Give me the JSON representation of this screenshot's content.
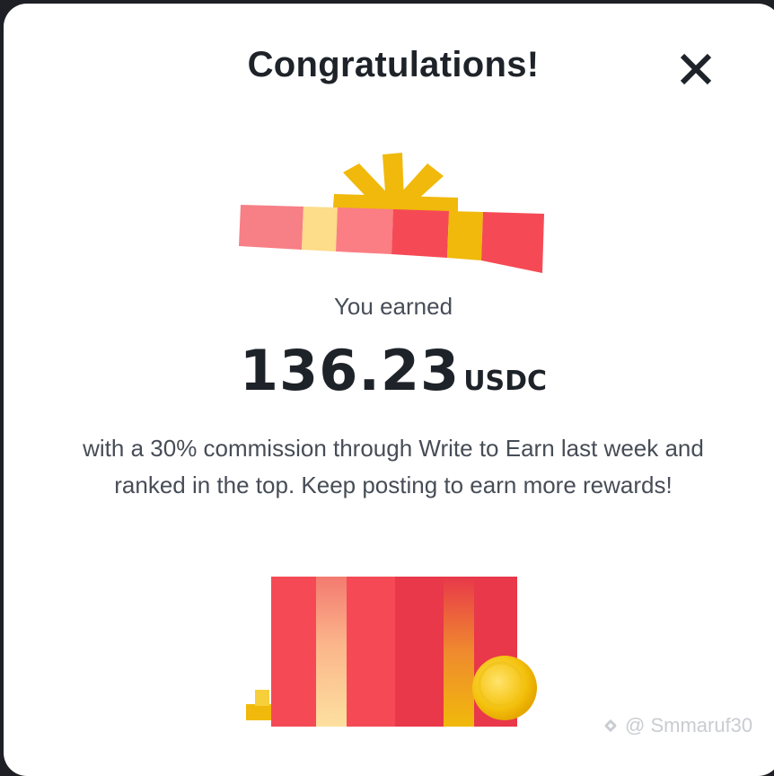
{
  "dialog": {
    "title": "Congratulations!",
    "close_icon": "close-icon",
    "earned_label": "You earned",
    "amount": "136.23",
    "currency": "USDC",
    "message": "with a 30% commission through Write to Earn last week and ranked in the top. Keep posting to earn more rewards!",
    "illustration": "gift-box-illustration"
  },
  "watermark": {
    "icon": "binance-logo-icon",
    "text": "@ Smmaruf30"
  },
  "colors": {
    "background": "#ffffff",
    "text_primary": "#1e2329",
    "text_secondary": "#474d57",
    "gift_red": "#f6465d",
    "gift_yellow": "#f0b90b"
  }
}
